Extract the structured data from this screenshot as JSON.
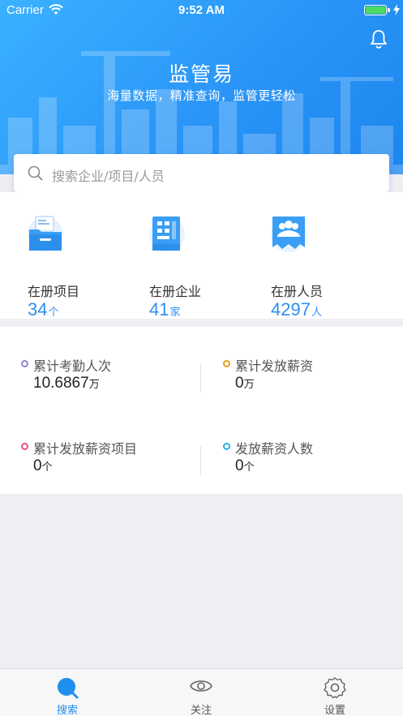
{
  "status_bar": {
    "carrier": "Carrier",
    "time": "9:52 AM"
  },
  "header": {
    "title": "监管易",
    "slogan": "海量数据，精准查询，监管更轻松"
  },
  "search": {
    "placeholder": "搜索企业/项目/人员"
  },
  "stats": [
    {
      "label": "在册项目",
      "value": "34",
      "unit": "个",
      "icon": "folder-icon"
    },
    {
      "label": "在册企业",
      "value": "41",
      "unit": "家",
      "icon": "building-icon"
    },
    {
      "label": "在册人员",
      "value": "4297",
      "unit": "人",
      "icon": "people-icon"
    }
  ],
  "metrics": [
    {
      "label": "累计考勤人次",
      "value": "10.6867",
      "unit": "万",
      "dot_color": "#8c86cf"
    },
    {
      "label": "累计发放薪资",
      "value": "0",
      "unit": "万",
      "dot_color": "#e7a21e"
    },
    {
      "label": "累计发放薪资项目",
      "value": "0",
      "unit": "个",
      "dot_color": "#e8507a"
    },
    {
      "label": "发放薪资人数",
      "value": "0",
      "unit": "个",
      "dot_color": "#2bb0e8"
    }
  ],
  "tabs": [
    {
      "label": "搜索",
      "icon": "search-tab-icon",
      "active": true
    },
    {
      "label": "关注",
      "icon": "eye-icon",
      "active": false
    },
    {
      "label": "设置",
      "icon": "gear-icon",
      "active": false
    }
  ],
  "colors": {
    "brand": "#2a95f7",
    "accent_text": "#2f8ff0",
    "background": "#eeeef3"
  }
}
